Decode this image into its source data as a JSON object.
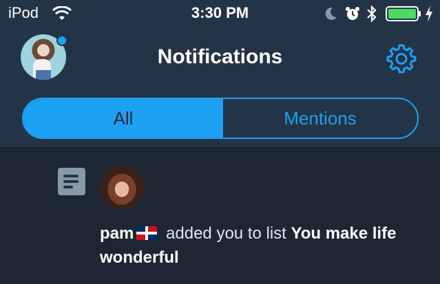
{
  "status_bar": {
    "carrier": "iPod",
    "time": "3:30 PM",
    "battery_color": "#4cd964"
  },
  "header": {
    "title": "Notifications",
    "settings_icon": "gear-icon",
    "avatar_badge_color": "#1da1f2"
  },
  "tabs": {
    "all_label": "All",
    "mentions_label": "Mentions",
    "selected": "All",
    "accent_color": "#1da1f2"
  },
  "notifications": [
    {
      "icon": "list-icon",
      "user": "pam",
      "flag": "Dominican Republic flag",
      "action": "added you to list",
      "list_name": "You make life wonderful"
    }
  ],
  "colors": {
    "background": "#1c2733",
    "header_background": "#243447"
  }
}
